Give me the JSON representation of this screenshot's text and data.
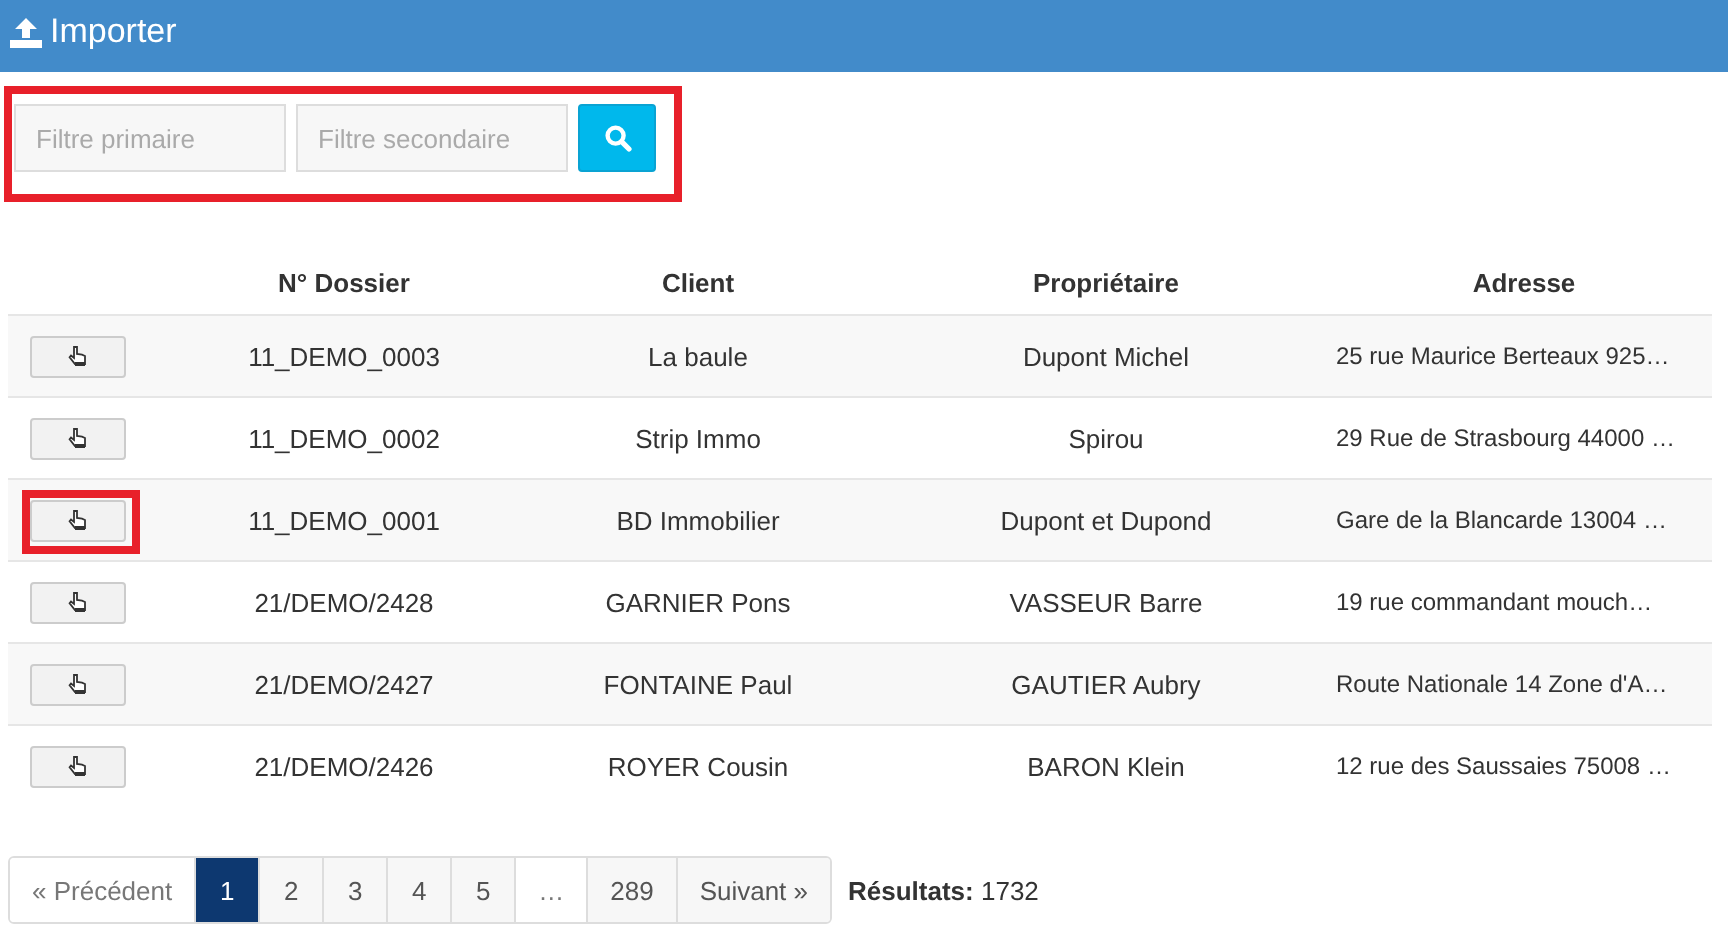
{
  "header": {
    "title": "Importer"
  },
  "filters": {
    "highlighted": true,
    "primary": {
      "placeholder": "Filtre primaire"
    },
    "secondary": {
      "placeholder": "Filtre secondaire"
    }
  },
  "table": {
    "columns": [
      "N° Dossier",
      "Client",
      "Propriétaire",
      "Adresse"
    ],
    "rows": [
      {
        "highlighted": false,
        "cells": [
          "11_DEMO_0003",
          "La baule",
          "Dupont Michel",
          "25 rue Maurice Berteaux 925…"
        ]
      },
      {
        "highlighted": false,
        "cells": [
          "11_DEMO_0002",
          "Strip Immo",
          "Spirou",
          "29 Rue de Strasbourg 44000 …"
        ]
      },
      {
        "highlighted": true,
        "cells": [
          "11_DEMO_0001",
          "BD Immobilier",
          "Dupont et Dupond",
          "Gare de la Blancarde 13004 …"
        ]
      },
      {
        "highlighted": false,
        "cells": [
          "21/DEMO/2428",
          "GARNIER Pons",
          "VASSEUR Barre",
          "19 rue commandant mouch…"
        ]
      },
      {
        "highlighted": false,
        "cells": [
          "21/DEMO/2427",
          "FONTAINE Paul",
          "GAUTIER Aubry",
          "Route Nationale 14 Zone d'A…"
        ]
      },
      {
        "highlighted": false,
        "cells": [
          "21/DEMO/2426",
          "ROYER Cousin",
          "BARON Klein",
          "12 rue des Saussaies 75008 …"
        ]
      }
    ]
  },
  "pagination": {
    "pages": [
      {
        "label": "« Précédent",
        "selected": false,
        "disabled": true
      },
      {
        "label": "1",
        "selected": true,
        "disabled": false
      },
      {
        "label": "2",
        "selected": false,
        "disabled": false
      },
      {
        "label": "3",
        "selected": false,
        "disabled": false
      },
      {
        "label": "4",
        "selected": false,
        "disabled": false
      },
      {
        "label": "5",
        "selected": false,
        "disabled": false
      },
      {
        "label": "…",
        "selected": false,
        "disabled": true
      },
      {
        "label": "289",
        "selected": false,
        "disabled": false
      },
      {
        "label": "Suivant »",
        "selected": false,
        "disabled": false
      }
    ],
    "results_label": "Résultats:",
    "results_count": "1732"
  }
}
